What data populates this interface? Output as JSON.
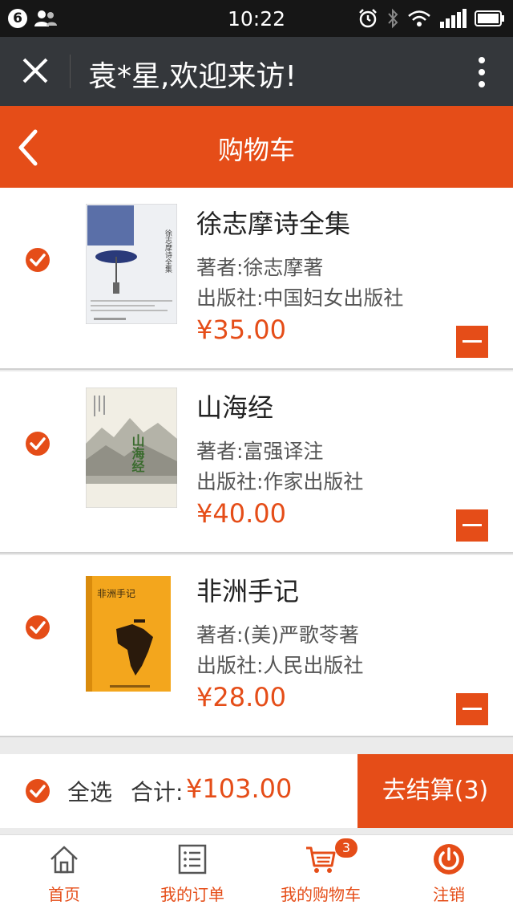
{
  "status_bar": {
    "notification_count": "6",
    "time": "10:22",
    "icons": [
      "contacts-icon",
      "alarm-icon",
      "bluetooth-icon",
      "wifi-icon",
      "signal-icon",
      "battery-icon"
    ]
  },
  "wechat_header": {
    "title": "袁*星,欢迎来访!",
    "close_icon": "close-icon",
    "more_icon": "more-vertical-icon"
  },
  "nav": {
    "title": "购物车",
    "back_icon": "chevron-left-icon"
  },
  "colors": {
    "accent": "#e54d18",
    "header_bg": "#34373b",
    "status_bg": "#161616"
  },
  "cart": {
    "items": [
      {
        "title": "徐志摩诗全集",
        "author": "著者:徐志摩著",
        "publisher": "出版社:中国妇女出版社",
        "price": "¥35.00",
        "checked": true
      },
      {
        "title": "山海经",
        "author": "著者:富强译注",
        "publisher": "出版社:作家出版社",
        "price": "¥40.00",
        "checked": true
      },
      {
        "title": "非洲手记",
        "author": "著者:(美)严歌苓著",
        "publisher": "出版社:人民出版社",
        "price": "¥28.00",
        "checked": true
      }
    ],
    "covers": {
      "book1": {
        "title_vertical": "徐志摩诗全集"
      },
      "book2": {
        "title_vertical": "山海经"
      },
      "book3": {
        "title": "非洲手记"
      }
    }
  },
  "checkout": {
    "select_all_label": "全选",
    "total_label": "合计:",
    "total_value": "¥103.00",
    "button_label": "去结算(3)"
  },
  "tabbar": {
    "tabs": [
      {
        "label": "首页",
        "icon": "home-icon"
      },
      {
        "label": "我的订单",
        "icon": "orders-icon"
      },
      {
        "label": "我的购物车",
        "icon": "cart-icon",
        "badge": "3"
      },
      {
        "label": "注销",
        "icon": "power-icon"
      }
    ]
  }
}
